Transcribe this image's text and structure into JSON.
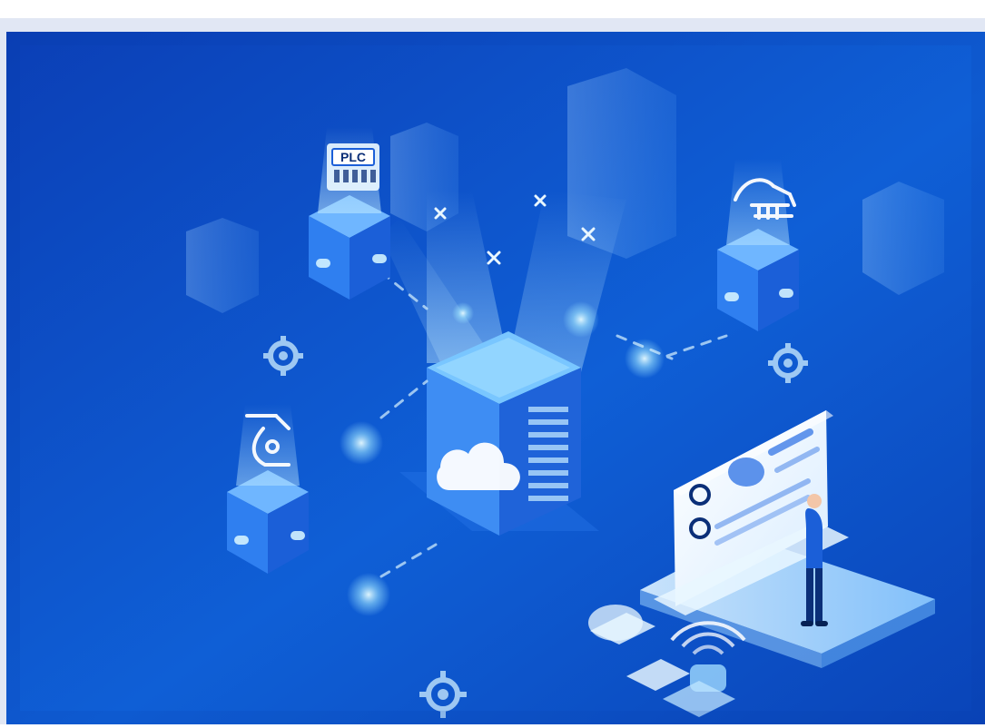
{
  "scene": {
    "labels": {
      "plc_panel_text": "PLC"
    },
    "colors": {
      "page_bg": "#ffffff",
      "scene_bg_top": "#0b3fb6",
      "scene_bg_mid": "#0f5fd6",
      "scene_bg_bottom": "#0a44b8",
      "cube_top": "#6fb6ff",
      "cube_left": "#2f7ff0",
      "cube_right": "#1b5fd8",
      "glow": "#bfe9ff",
      "monitor_white": "#f2f8ff",
      "person_blue": "#0b2f78"
    },
    "icons": [
      "plc-panel-icon",
      "robot-arm-icon",
      "robot-arm-2-icon",
      "gear-icon",
      "cloud-icon",
      "wifi-icon",
      "dashboard-monitor-icon",
      "person-icon",
      "server-tower-icon"
    ]
  }
}
